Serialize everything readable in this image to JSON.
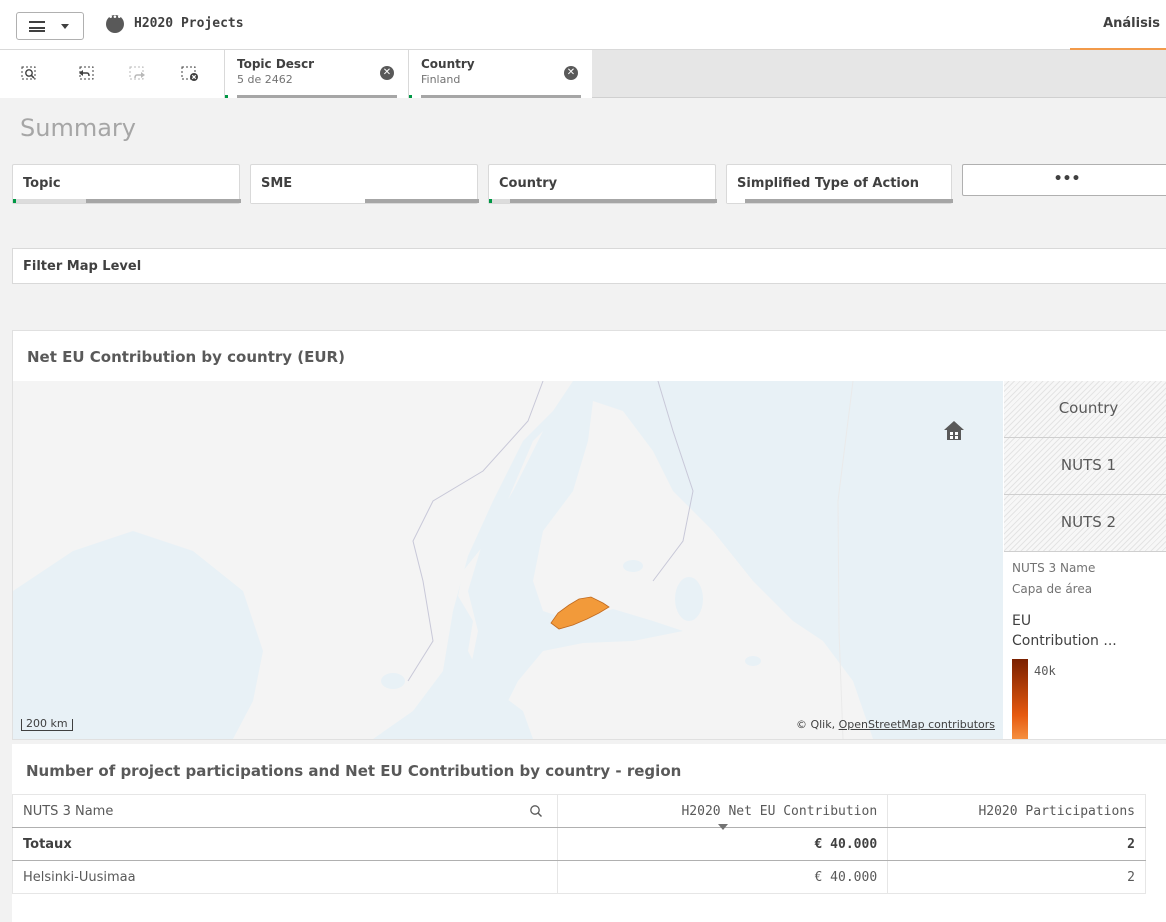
{
  "app": {
    "title": "H2020 Projects",
    "tab_label": "Análisis"
  },
  "selections": [
    {
      "title": "Topic Descr",
      "value": "5 de 2462"
    },
    {
      "title": "Country",
      "value": "Finland"
    }
  ],
  "sheet": {
    "title": "Summary"
  },
  "filters": {
    "topic": "Topic",
    "sme": "SME",
    "country": "Country",
    "type_of_action": "Simplified Type of Action",
    "more": "•••",
    "map_level": "Filter Map Level"
  },
  "map": {
    "title": "Net EU Contribution by country (EUR)",
    "scale": "200 km",
    "attribution_prefix": "© Qlik, ",
    "attribution_link": "OpenStreetMap contributors",
    "levels": [
      "Country",
      "NUTS 1",
      "NUTS 2"
    ],
    "legend": {
      "dimension": "NUTS 3 Name",
      "layer": "Capa de área",
      "measure_line1": "EU",
      "measure_line2": "Contribution ...",
      "max_value": "40k"
    },
    "colors": {
      "water": "#e8f1f6",
      "land": "#f4f4f4",
      "highlight": "#f29a3a"
    }
  },
  "table": {
    "title": "Number of project participations and Net EU Contribution by country - region",
    "columns": [
      "NUTS 3 Name",
      "H2020 Net EU Contribution",
      "H2020 Participations"
    ],
    "total": {
      "label": "Totaux",
      "contribution": "€ 40.000",
      "participations": "2"
    },
    "rows": [
      {
        "name": "Helsinki-Uusimaa",
        "contribution": "€ 40.000",
        "participations": "2"
      }
    ]
  }
}
